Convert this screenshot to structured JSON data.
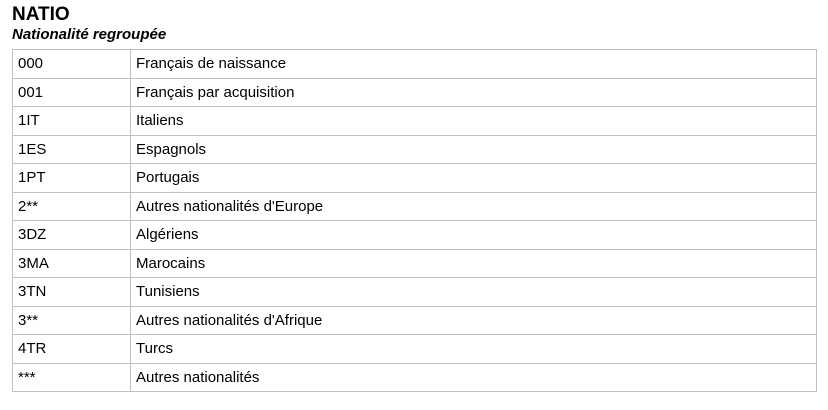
{
  "header": {
    "title": "NATIO",
    "subtitle": "Nationalité regroupée"
  },
  "rows": [
    {
      "code": "000",
      "label": "Français de naissance"
    },
    {
      "code": "001",
      "label": "Français par acquisition"
    },
    {
      "code": "1IT",
      "label": "Italiens"
    },
    {
      "code": "1ES",
      "label": "Espagnols"
    },
    {
      "code": "1PT",
      "label": "Portugais"
    },
    {
      "code": "2**",
      "label": "Autres nationalités d'Europe"
    },
    {
      "code": "3DZ",
      "label": "Algériens"
    },
    {
      "code": "3MA",
      "label": "Marocains"
    },
    {
      "code": "3TN",
      "label": "Tunisiens"
    },
    {
      "code": "3**",
      "label": "Autres nationalités d'Afrique"
    },
    {
      "code": "4TR",
      "label": "Turcs"
    },
    {
      "code": "***",
      "label": "Autres nationalités"
    }
  ]
}
